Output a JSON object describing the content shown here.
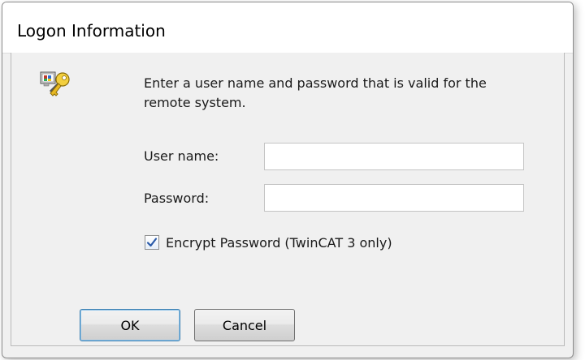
{
  "dialog": {
    "title": "Logon Information",
    "instruction": "Enter a user name and password that is valid for the remote system.",
    "icon": "logon-keys-icon"
  },
  "fields": {
    "username_label": "User name:",
    "username_value": "",
    "password_label": "Password:",
    "password_value": ""
  },
  "options": {
    "encrypt_label": "Encrypt Password (TwinCAT 3 only)",
    "encrypt_checked": true
  },
  "buttons": {
    "ok_label": "OK",
    "cancel_label": "Cancel"
  },
  "colors": {
    "dialog_background": "#f0f0f0",
    "title_background": "#ffffff",
    "checkmark": "#2a5aa8",
    "default_button_border": "#3c7fb1"
  }
}
